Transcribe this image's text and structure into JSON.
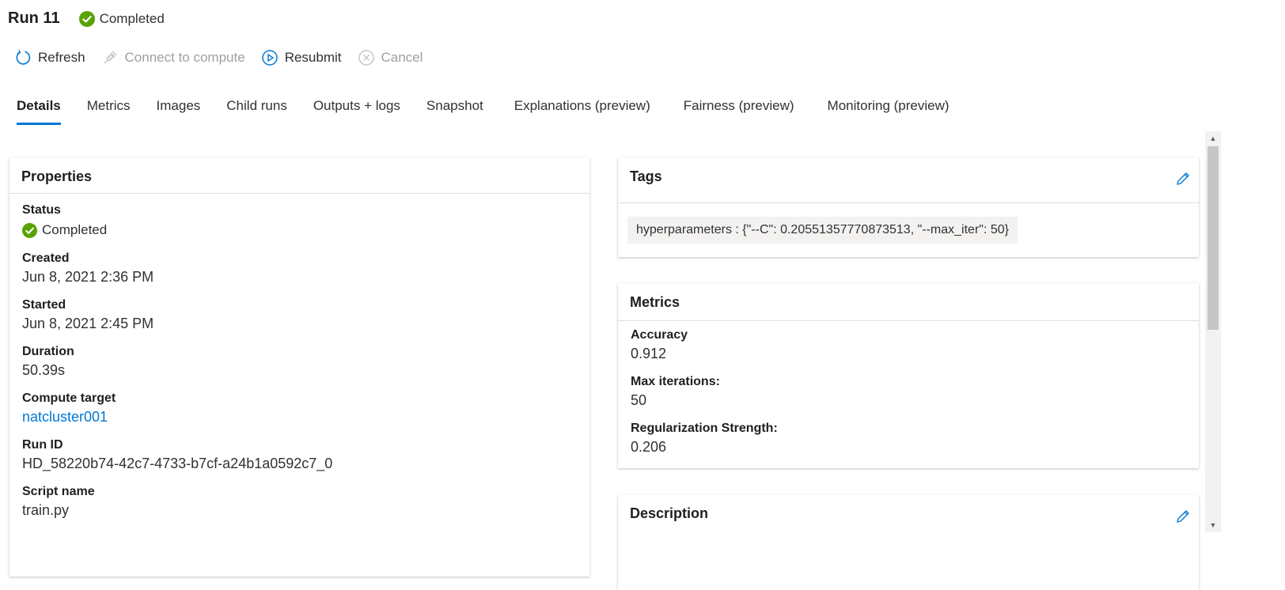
{
  "header": {
    "title": "Run 11",
    "status": "Completed"
  },
  "toolbar": {
    "refresh": "Refresh",
    "connect": "Connect to compute",
    "resubmit": "Resubmit",
    "cancel": "Cancel"
  },
  "tabs": [
    "Details",
    "Metrics",
    "Images",
    "Child runs",
    "Outputs + logs",
    "Snapshot",
    "Explanations (preview)",
    "Fairness (preview)",
    "Monitoring (preview)"
  ],
  "properties": {
    "title": "Properties",
    "fields": [
      {
        "label": "Status",
        "value": "Completed"
      },
      {
        "label": "Created",
        "value": "Jun 8, 2021 2:36 PM"
      },
      {
        "label": "Started",
        "value": "Jun 8, 2021 2:45 PM"
      },
      {
        "label": "Duration",
        "value": "50.39s"
      },
      {
        "label": "Compute target",
        "value": "natcluster001"
      },
      {
        "label": "Run ID",
        "value": "HD_58220b74-42c7-4733-b7cf-a24b1a0592c7_0"
      },
      {
        "label": "Script name",
        "value": "train.py"
      }
    ]
  },
  "tags": {
    "title": "Tags",
    "items": [
      "hyperparameters : {\"--C\": 0.20551357770873513, \"--max_iter\": 50}"
    ]
  },
  "metrics": {
    "title": "Metrics",
    "fields": [
      {
        "label": "Accuracy",
        "value": "0.912"
      },
      {
        "label": "Max iterations:",
        "value": "50"
      },
      {
        "label": "Regularization Strength:",
        "value": "0.206"
      }
    ]
  },
  "description": {
    "title": "Description"
  },
  "colors": {
    "accent": "#0078d4",
    "success": "#57a300"
  }
}
